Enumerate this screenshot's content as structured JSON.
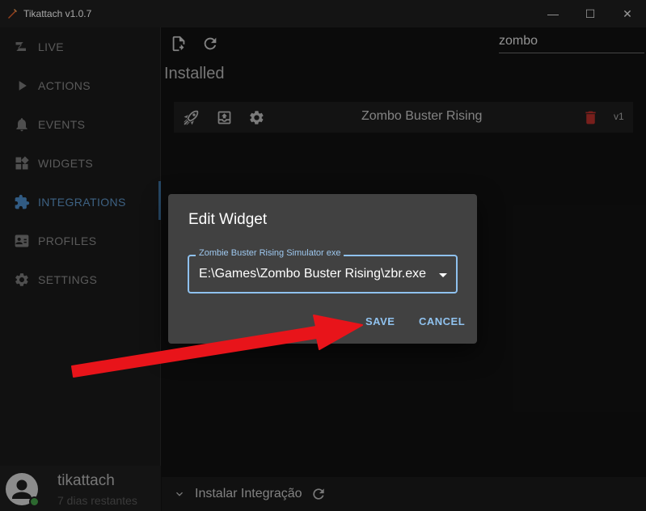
{
  "window": {
    "title": "Tikattach v1.0.7",
    "controls": {
      "minimize": "—",
      "maximize": "☐",
      "close": "✕"
    }
  },
  "sidebar": {
    "items": [
      {
        "label": "LIVE",
        "icon": "live-icon",
        "active": false
      },
      {
        "label": "ACTIONS",
        "icon": "play-icon",
        "active": false
      },
      {
        "label": "EVENTS",
        "icon": "bell-icon",
        "active": false
      },
      {
        "label": "WIDGETS",
        "icon": "widgets-icon",
        "active": false
      },
      {
        "label": "INTEGRATIONS",
        "icon": "puzzle-icon",
        "active": true
      },
      {
        "label": "PROFILES",
        "icon": "profile-card-icon",
        "active": false
      },
      {
        "label": "SETTINGS",
        "icon": "gear-icon",
        "active": false
      }
    ],
    "user": {
      "name": "tikattach",
      "subtitle": "7 dias restantes",
      "status": "online"
    }
  },
  "main": {
    "search_value": "zombo",
    "section_title": "Installed",
    "widgets": [
      {
        "name": "Zombo Buster Rising",
        "version": "v1"
      }
    ],
    "bottom_bar": {
      "label": "Instalar Integração"
    }
  },
  "dialog": {
    "title": "Edit Widget",
    "field_label": "Zombie Buster Rising Simulator exe",
    "field_value": "E:\\Games\\Zombo Buster Rising\\zbr.exe",
    "save_label": "SAVE",
    "cancel_label": "CANCEL"
  },
  "colors": {
    "accent": "#5e95c8",
    "field_border": "#8fc1ef",
    "delete": "#b8302b",
    "arrow": "#e8141a",
    "online": "#46a24a"
  }
}
